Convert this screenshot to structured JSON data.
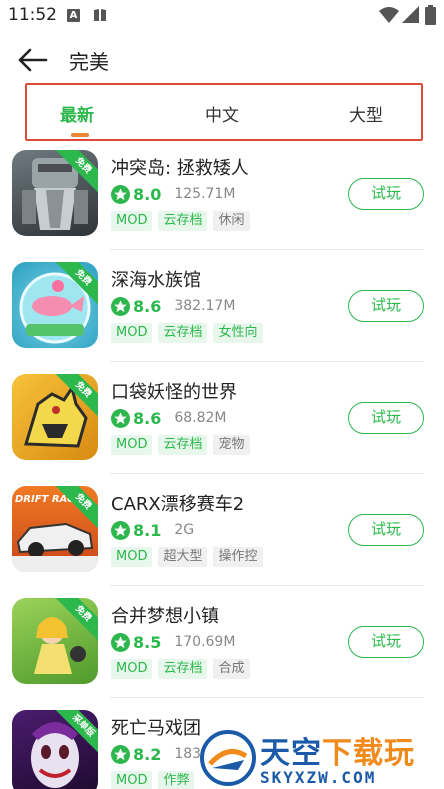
{
  "status_bar": {
    "time": "11:52",
    "a_icon_label": "A"
  },
  "header": {
    "title": "完美"
  },
  "tabs": [
    {
      "label": "最新",
      "active": true
    },
    {
      "label": "中文",
      "active": false
    },
    {
      "label": "大型",
      "active": false
    }
  ],
  "apps": [
    {
      "name": "冲突岛: 拯救矮人",
      "rating": "8.0",
      "size": "125.71M",
      "badge": "免费",
      "tags": [
        {
          "label": "MOD",
          "style": "green"
        },
        {
          "label": "云存档",
          "style": "green"
        },
        {
          "label": "休闲",
          "style": "grey"
        }
      ],
      "button": "试玩"
    },
    {
      "name": "深海水族馆",
      "rating": "8.6",
      "size": "382.17M",
      "badge": "免费",
      "tags": [
        {
          "label": "MOD",
          "style": "green"
        },
        {
          "label": "云存档",
          "style": "green"
        },
        {
          "label": "女性向",
          "style": "green"
        }
      ],
      "button": "试玩"
    },
    {
      "name": "口袋妖怪的世界",
      "rating": "8.6",
      "size": "68.82M",
      "badge": "免费",
      "tags": [
        {
          "label": "MOD",
          "style": "green"
        },
        {
          "label": "云存档",
          "style": "green"
        },
        {
          "label": "宠物",
          "style": "grey"
        }
      ],
      "button": "试玩"
    },
    {
      "name": "CARX漂移赛车2",
      "rating": "8.1",
      "size": "2G",
      "badge": "免费",
      "icon_text": "DRIFT RACIN",
      "tags": [
        {
          "label": "MOD",
          "style": "green"
        },
        {
          "label": "超大型",
          "style": "grey"
        },
        {
          "label": "操作控",
          "style": "grey"
        }
      ],
      "button": "试玩"
    },
    {
      "name": "合并梦想小镇",
      "rating": "8.5",
      "size": "170.69M",
      "badge": "免费",
      "tags": [
        {
          "label": "MOD",
          "style": "green"
        },
        {
          "label": "云存档",
          "style": "green"
        },
        {
          "label": "合成",
          "style": "grey"
        }
      ],
      "button": "试玩"
    },
    {
      "name": "死亡马戏团",
      "rating": "8.2",
      "size": "183.",
      "badge": "采单版",
      "tags": [
        {
          "label": "MOD",
          "style": "green"
        },
        {
          "label": "作弊",
          "style": "green"
        }
      ],
      "button": "试玩"
    }
  ],
  "watermark": {
    "line1_a": "天空",
    "line1_b": "下载玩",
    "line2": "SKYXZW.COM"
  },
  "colors": {
    "accent": "#2db84d",
    "tab_border": "#e04a3a",
    "underline": "#e8873a"
  }
}
